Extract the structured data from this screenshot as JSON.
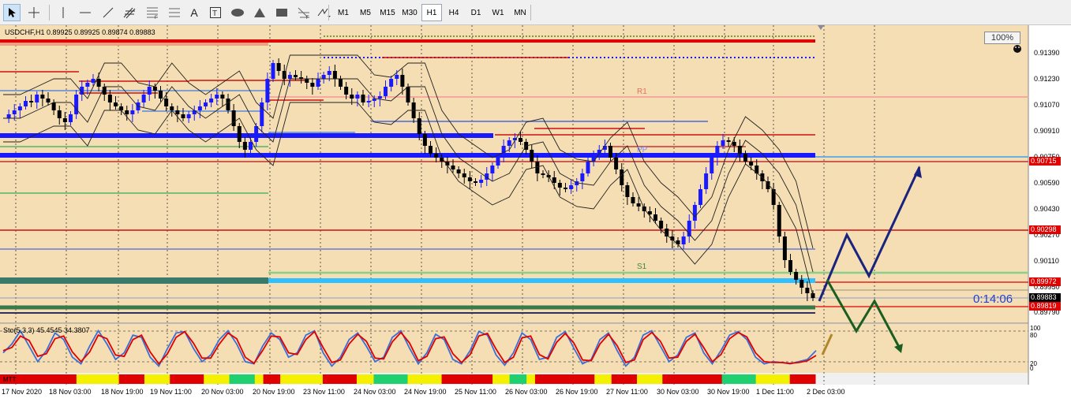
{
  "toolbar": {
    "tools": [
      "cursor-icon",
      "crosshair-icon",
      "vertical-line-icon",
      "horizontal-line-icon",
      "trendline-icon",
      "fibonacci-channel-icon",
      "fibonacci-fan-icon",
      "text-icon",
      "text-label-icon",
      "ellipse-icon",
      "triangle-icon",
      "rectangle-icon",
      "fibonacci-expansion-icon",
      "arrow-tools-icon"
    ],
    "text_tool": "A",
    "timeframes": [
      "M1",
      "M5",
      "M15",
      "M30",
      "H1",
      "H4",
      "D1",
      "W1",
      "MN"
    ],
    "active_timeframe": "H1"
  },
  "chart": {
    "symbol_line": "USDCHF,H1  0.89925 0.89925 0.89874 0.89883",
    "zoom": "100%",
    "countdown": "0:14:06",
    "price_axis": [
      "0.91390",
      "0.91230",
      "0.91070",
      "0.90910",
      "0.90750",
      "0.90590",
      "0.90430",
      "0.90270",
      "0.90110",
      "0.89950",
      "0.89790"
    ],
    "price_tags": [
      {
        "value": "0.90715",
        "color": "#e00000"
      },
      {
        "value": "0.90298",
        "color": "#e00000"
      },
      {
        "value": "0.89972",
        "color": "#e00000"
      },
      {
        "value": "0.89883",
        "color": "#000000"
      },
      {
        "value": "0.89819",
        "color": "#e00000"
      }
    ],
    "level_labels": [
      "R1",
      "PP",
      "S1"
    ],
    "time_axis": [
      "17 Nov 2020",
      "18 Nov 03:00",
      "18 Nov 19:00",
      "19 Nov 11:00",
      "20 Nov 03:00",
      "20 Nov 19:00",
      "23 Nov 11:00",
      "24 Nov 03:00",
      "24 Nov 19:00",
      "25 Nov 11:00",
      "26 Nov 03:00",
      "26 Nov 19:00",
      "27 Nov 11:00",
      "30 Nov 03:00",
      "30 Nov 19:00",
      "1 Dec 11:00",
      "2 Dec 03:00"
    ],
    "colors": {
      "background": "#f5deb3",
      "bull": "#1a1aff",
      "bear": "#000000",
      "stoch_main": "#3a6fd8",
      "stoch_signal": "#e00000"
    }
  },
  "oscillator": {
    "label": "Sto(5,3,3) 45.4545 34.3807",
    "levels": [
      "100",
      "80",
      "20",
      "0"
    ],
    "main_line": [
      40,
      60,
      90,
      55,
      20,
      45,
      85,
      70,
      30,
      15,
      55,
      90,
      60,
      25,
      40,
      80,
      75,
      30,
      10,
      50,
      85,
      88,
      50,
      20,
      35,
      70,
      90,
      60,
      20,
      15,
      55,
      85,
      70,
      30,
      40,
      80,
      90,
      40,
      10,
      30,
      70,
      85,
      55,
      20,
      30,
      75,
      90,
      50,
      15,
      40,
      82,
      70,
      25,
      15,
      45,
      88,
      80,
      35,
      12,
      40,
      85,
      70,
      25,
      30,
      75,
      88,
      50,
      15,
      25,
      70,
      85,
      45,
      10,
      30,
      80,
      90,
      55,
      20,
      35,
      75,
      85,
      40,
      15,
      45,
      80,
      88,
      70,
      30,
      15,
      20,
      18,
      15,
      20,
      25,
      45
    ],
    "signal_line": [
      45,
      52,
      78,
      68,
      32,
      38,
      72,
      78,
      42,
      20,
      42,
      80,
      72,
      35,
      32,
      70,
      80,
      42,
      15,
      38,
      75,
      88,
      62,
      28,
      28,
      60,
      85,
      72,
      30,
      16,
      45,
      78,
      76,
      40,
      36,
      70,
      88,
      52,
      18,
      24,
      60,
      82,
      66,
      28,
      26,
      65,
      86,
      62,
      22,
      32,
      72,
      76,
      38,
      18,
      36,
      78,
      84,
      48,
      18,
      30,
      74,
      78,
      36,
      26,
      64,
      84,
      62,
      24,
      22,
      60,
      82,
      56,
      18,
      24,
      70,
      86,
      66,
      28,
      30,
      66,
      82,
      52,
      20,
      36,
      72,
      86,
      76,
      40,
      20,
      18,
      18,
      16,
      18,
      22,
      34
    ]
  },
  "mtt_label": "MTT",
  "mtt_bar": [
    "r",
    "r",
    "r",
    "r",
    "r",
    "r",
    "r",
    "r",
    "r",
    "y",
    "y",
    "y",
    "y",
    "y",
    "r",
    "r",
    "r",
    "y",
    "y",
    "y",
    "r",
    "r",
    "r",
    "r",
    "y",
    "y",
    "y",
    "g",
    "g",
    "g",
    "y",
    "r",
    "r",
    "y",
    "y",
    "y",
    "y",
    "y",
    "r",
    "r",
    "r",
    "r",
    "y",
    "y",
    "g",
    "g",
    "g",
    "g",
    "y",
    "y",
    "y",
    "y",
    "r",
    "r",
    "r",
    "r",
    "r",
    "r",
    "y",
    "y",
    "g",
    "g",
    "y",
    "r",
    "r",
    "r",
    "r",
    "r",
    "r",
    "r",
    "y",
    "y",
    "r",
    "r",
    "r",
    "y",
    "y",
    "y",
    "r",
    "r",
    "r",
    "r",
    "r",
    "r",
    "r",
    "g",
    "g",
    "g",
    "g",
    "y",
    "y",
    "y",
    "y",
    "r",
    "r",
    "r"
  ]
}
